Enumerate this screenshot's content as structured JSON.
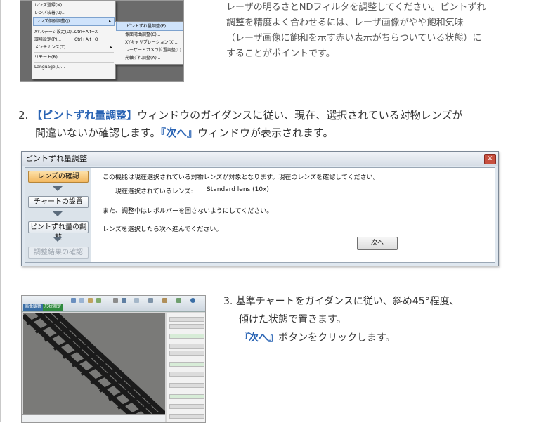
{
  "top_screenshot": {
    "menu_items": [
      {
        "label": "レンズ登録(N)...",
        "shortcut": "",
        "submenu": false
      },
      {
        "label": "レンズ装着(U)...",
        "shortcut": "",
        "submenu": false
      },
      {
        "label": "レンズ個別調整(J)",
        "shortcut": "",
        "submenu": true
      },
      {
        "label": "XYステージ設定(D)...",
        "shortcut": "Ctrl+Alt+X",
        "submenu": false
      },
      {
        "label": "環境設定(P)...",
        "shortcut": "Ctrl+Alt+O",
        "submenu": false
      },
      {
        "label": "メンテナンス(T)",
        "shortcut": "",
        "submenu": true
      },
      {
        "label": "リモート(R)...",
        "shortcut": "",
        "submenu": false
      },
      {
        "label": "Language(L)...",
        "shortcut": "",
        "submenu": false
      }
    ],
    "submenu_items": [
      "ピントずれ量調整(F)...",
      "像面湾曲調整(C)...",
      "XYキャリブレーション(X)...",
      "レーザー・カメラ位置調整(L)...",
      "光軸ずれ調整(A)..."
    ]
  },
  "top_paragraph": [
    "レーザの明るさとNDフィルタを調整してください。ピントずれ",
    "調整を精度よく合わせるには、レーザ画像がやや飽和気味",
    "（レーザ画像に飽和を示す赤い表示がちらついている状態）に",
    "することがポイントです。"
  ],
  "step2": {
    "number": "2.",
    "highlight1": "【ピントずれ量調整】",
    "text1": "ウィンドウのガイダンスに従い、現在、選択されている対物レンズが",
    "text2a": "間違いないか確認します。",
    "highlight2": "『次へ』",
    "text2b": "ウィンドウが表示されます。"
  },
  "dialog": {
    "title": "ピントずれ量調整",
    "close_glyph": "×",
    "steps": [
      "レンズの確認",
      "チャートの設置",
      "ピントずれ量の調整",
      "調整結果の確認"
    ],
    "line1": "この機能は現在選択されている対物レンズが対象となります。現在のレンズを確認してください。",
    "lens_label": "現在選択されているレンズ:",
    "lens_value": "Standard lens (10x)",
    "line3": "また、調整中はレボルバーを回さないようにしてください。",
    "line4": "レンズを選択したら次へ進んでください。",
    "next_label": "次へ"
  },
  "bottom_screenshot": {
    "tab1": "画像観察",
    "tab2": "形状測定"
  },
  "step3": {
    "number": "3.",
    "text1": "基準チャートをガイダンスに従い、斜め45°程度、",
    "text2": "傾けた状態で置きます。",
    "highlight": "『次へ』",
    "text3": "ボタンをクリックします。"
  },
  "colors": {
    "accent_blue": "#2a64b4",
    "active_step": "#f3b860"
  }
}
